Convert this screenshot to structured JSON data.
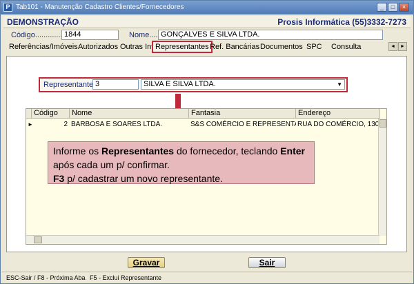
{
  "window": {
    "title": "Tab101 - Manutenção Cadastro Clientes/Fornecedores",
    "app_icon": "P"
  },
  "header": {
    "company": "DEMONSTRAÇÃO",
    "vendor": "Prosis Informática (55)3332-7273"
  },
  "record": {
    "code_label": "Código...............:",
    "code_value": "1844",
    "name_label": "Nome.....:",
    "name_value": "GONÇALVES E SILVA LTDA."
  },
  "tabs": [
    {
      "label": "Referências/Imóveis"
    },
    {
      "label": "Autorizados"
    },
    {
      "label": "Outras Inf."
    },
    {
      "label": "Representantes",
      "active": true
    },
    {
      "label": "Ref. Bancárias"
    },
    {
      "label": "Documentos"
    },
    {
      "label": "SPC"
    },
    {
      "label": "Consulta"
    }
  ],
  "tab_nav": {
    "prev_icon": "◄",
    "next_icon": "►"
  },
  "representative": {
    "label": "Representante:",
    "code": "3",
    "name": "SILVA E SILVA LTDA."
  },
  "grid": {
    "columns": [
      "Código",
      "Nome",
      "Fantasia",
      "Endereço"
    ],
    "rows": [
      {
        "codigo": "2",
        "nome": "BARBOSA E SOARES LTDA.",
        "fantasia": "S&S COMÉRCIO E REPRESENTA",
        "endereco": "RUA DO COMÉRCIO, 130"
      }
    ]
  },
  "callout": {
    "line1_a": "Informe os ",
    "line1_b": "Representantes",
    "line1_c": " do fornecedor, teclando ",
    "line1_d": "Enter",
    "line2": "após cada um p/ confirmar.",
    "line3_a": "F3",
    "line3_b": " p/ cadastrar um novo representante."
  },
  "buttons": {
    "save": "Gravar",
    "exit": "Sair"
  },
  "status": {
    "left": "ESC-Sair / F8 - Próxima Aba",
    "right": "F5 - Exclui Representante"
  },
  "colors": {
    "highlight": "#c0293a",
    "label_blue": "#1a2a78",
    "callout_bg": "#e7b9bc"
  }
}
